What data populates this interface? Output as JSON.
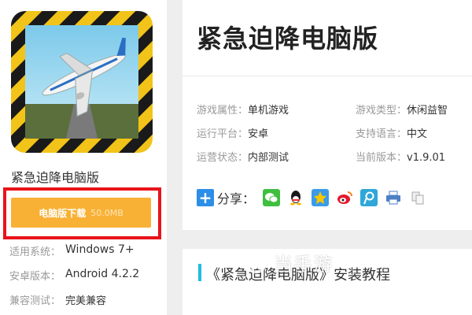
{
  "app": {
    "name": "紧急迫降电脑版",
    "download_label": "电脑版下载",
    "download_size": "50.0MB",
    "specs": [
      {
        "label": "适用系统：",
        "value": "Windows 7+"
      },
      {
        "label": "安卓版本：",
        "value": "Android 4.2.2"
      },
      {
        "label": "兼容测试：",
        "value": "完美兼容"
      }
    ]
  },
  "info": {
    "title": "紧急迫降电脑版",
    "attrs": [
      {
        "label": "游戏属性：",
        "value": "单机游戏"
      },
      {
        "label": "游戏类型：",
        "value": "休闲益智"
      },
      {
        "label": "运行平台：",
        "value": "安卓"
      },
      {
        "label": "支持语言：",
        "value": "中文"
      },
      {
        "label": "运营状态：",
        "value": "内部测试"
      },
      {
        "label": "当前版本：",
        "value": "v1.9.01"
      }
    ],
    "share_label": "分享：",
    "share_icons": [
      "wechat-icon",
      "qq-icon",
      "qzone-icon",
      "weibo-icon",
      "tencent-weibo-icon",
      "print-icon",
      "copy-icon"
    ]
  },
  "tutorial": {
    "title": "《紧急迫降电脑版》安装教程"
  },
  "watermark": {
    "text": "当手游"
  },
  "colors": {
    "download_button": "#f8b135",
    "highlight_border": "#e8131b",
    "tutorial_bar": "#1ebde0",
    "share_plus": "#2d8ee8"
  }
}
